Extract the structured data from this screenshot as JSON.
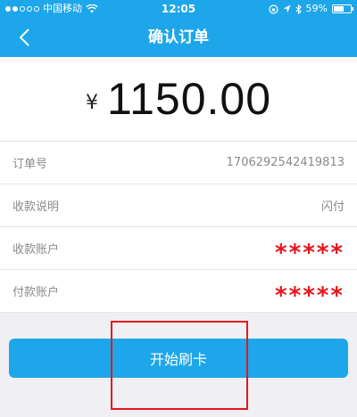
{
  "status_bar": {
    "carrier": "中国移动",
    "time": "12:05",
    "battery_text": "59%",
    "battery_level": 0.59,
    "icons": [
      "signal-dots-icon",
      "wifi-icon",
      "orientation-lock-icon",
      "location-icon",
      "bluetooth-icon",
      "battery-icon"
    ]
  },
  "nav": {
    "title": "确认订单",
    "back_icon": "chevron-left-icon"
  },
  "amount": {
    "currency": "¥",
    "value": "1150.00"
  },
  "details": [
    {
      "label": "订单号",
      "value": "1706292542419813",
      "masked": false
    },
    {
      "label": "收款说明",
      "value": "闪付",
      "masked": false
    },
    {
      "label": "收款账户",
      "value": "*****",
      "masked": true
    },
    {
      "label": "付款账户",
      "value": "*****",
      "masked": true
    }
  ],
  "actions": {
    "start_label": "开始刷卡"
  },
  "colors": {
    "brand": "#1ea6ea",
    "mask_red": "#e8151c",
    "background": "#f0f0f4"
  }
}
